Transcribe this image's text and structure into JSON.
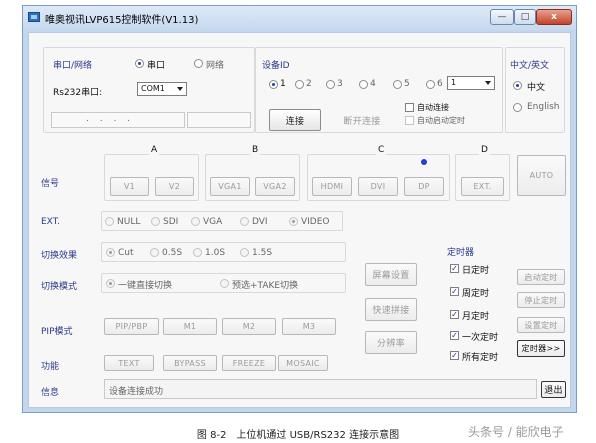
{
  "window": {
    "title": "唯奥视讯LVP615控制软件(V1.13)",
    "min": "—",
    "max": "□",
    "close": "x"
  },
  "port": {
    "group_label": "串口/网络",
    "opt_serial": "串口",
    "opt_network": "网络",
    "rs232_label": "Rs232串口:",
    "com_value": "COM1",
    "footer_dots": ". . . ."
  },
  "device": {
    "label": "设备ID",
    "ids": [
      "1",
      "2",
      "3",
      "4",
      "5",
      "6"
    ],
    "select_value": "1",
    "connect": "连接",
    "disconnect": "断开连接",
    "auto_connect": "自动连接",
    "auto_start_timer": "自动启动定时"
  },
  "language": {
    "label": "中文/英文",
    "zh": "中文",
    "en": "English"
  },
  "signal": {
    "label": "信号",
    "groups": [
      "A",
      "B",
      "C",
      "D"
    ],
    "buttons": [
      "V1",
      "V2",
      "VGA1",
      "VGA2",
      "HDMI",
      "DVI",
      "DP",
      "EXT."
    ],
    "auto": "AUTO"
  },
  "ext": {
    "label": "EXT.",
    "options": [
      "NULL",
      "SDI",
      "VGA",
      "DVI",
      "VIDEO"
    ]
  },
  "effect": {
    "label": "切换效果",
    "options": [
      "Cut",
      "0.5S",
      "1.0S",
      "1.5S"
    ]
  },
  "mode": {
    "label": "切换模式",
    "options": [
      "一键直接切换",
      "预选+TAKE切换"
    ]
  },
  "middle_buttons": {
    "screen": "屏幕设置",
    "shortcut": "快速拼接",
    "resolution": "分辨率"
  },
  "timer": {
    "label": "定时器",
    "checks": [
      "日定时",
      "周定时",
      "月定时",
      "一次定时",
      "所有定时"
    ],
    "buttons": [
      "启动定时",
      "停止定时",
      "设置定时",
      "定时器>>"
    ]
  },
  "pip": {
    "label": "PIP模式",
    "buttons": [
      "PIP/PBP",
      "M1",
      "M2",
      "M3"
    ]
  },
  "func": {
    "label": "功能",
    "buttons": [
      "TEXT",
      "BYPASS",
      "FREEZE",
      "MOSAIC"
    ]
  },
  "info": {
    "label": "信息",
    "message": "设备连接成功",
    "exit": "退出"
  },
  "caption": "图 8-2　上位机通过 USB/RS232 连接示意图",
  "watermark": "头条号 / 能欣电子"
}
